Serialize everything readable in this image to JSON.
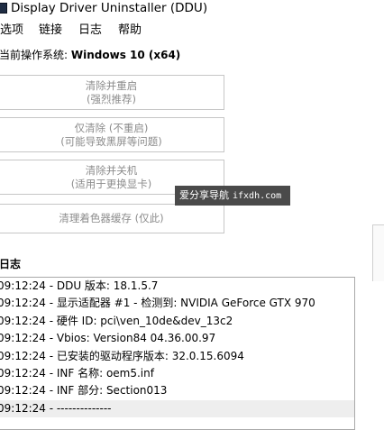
{
  "window": {
    "title": "Display Driver Uninstaller (DDU)"
  },
  "menu": {
    "items": [
      "选项",
      "链接",
      "日志",
      "帮助"
    ]
  },
  "os": {
    "label": "当前操作系统:",
    "value": "Windows 10 (x64)"
  },
  "actions": [
    {
      "line1": "清除并重启",
      "line2": "(强烈推荐)"
    },
    {
      "line1": "仅清除 (不重启)",
      "line2": "(可能导致黑屏等问题)"
    },
    {
      "line1": "清除并关机",
      "line2": "(适用于更换显卡)"
    },
    {
      "line1": "清理着色器缓存 (仅此)"
    }
  ],
  "watermark": {
    "text": "爱分享导航",
    "domain": "ifxdh.com"
  },
  "log": {
    "label": "日志",
    "lines": [
      "09:12:24 - DDU 版本: 18.1.5.7",
      "09:12:24 - 显示适配器 #1 - 检测到: NVIDIA GeForce GTX 970",
      "09:12:24 - 硬件 ID: pci\\ven_10de&dev_13c2",
      "09:12:24 - Vbios: Version84 04.36.00.97",
      "09:12:24 - 已安装的驱动程序版本: 32.0.15.6094",
      "09:12:24 - INF 名称: oem5.inf",
      "09:12:24 - INF 部分: Section013",
      "09:12:24 - --------------"
    ]
  }
}
